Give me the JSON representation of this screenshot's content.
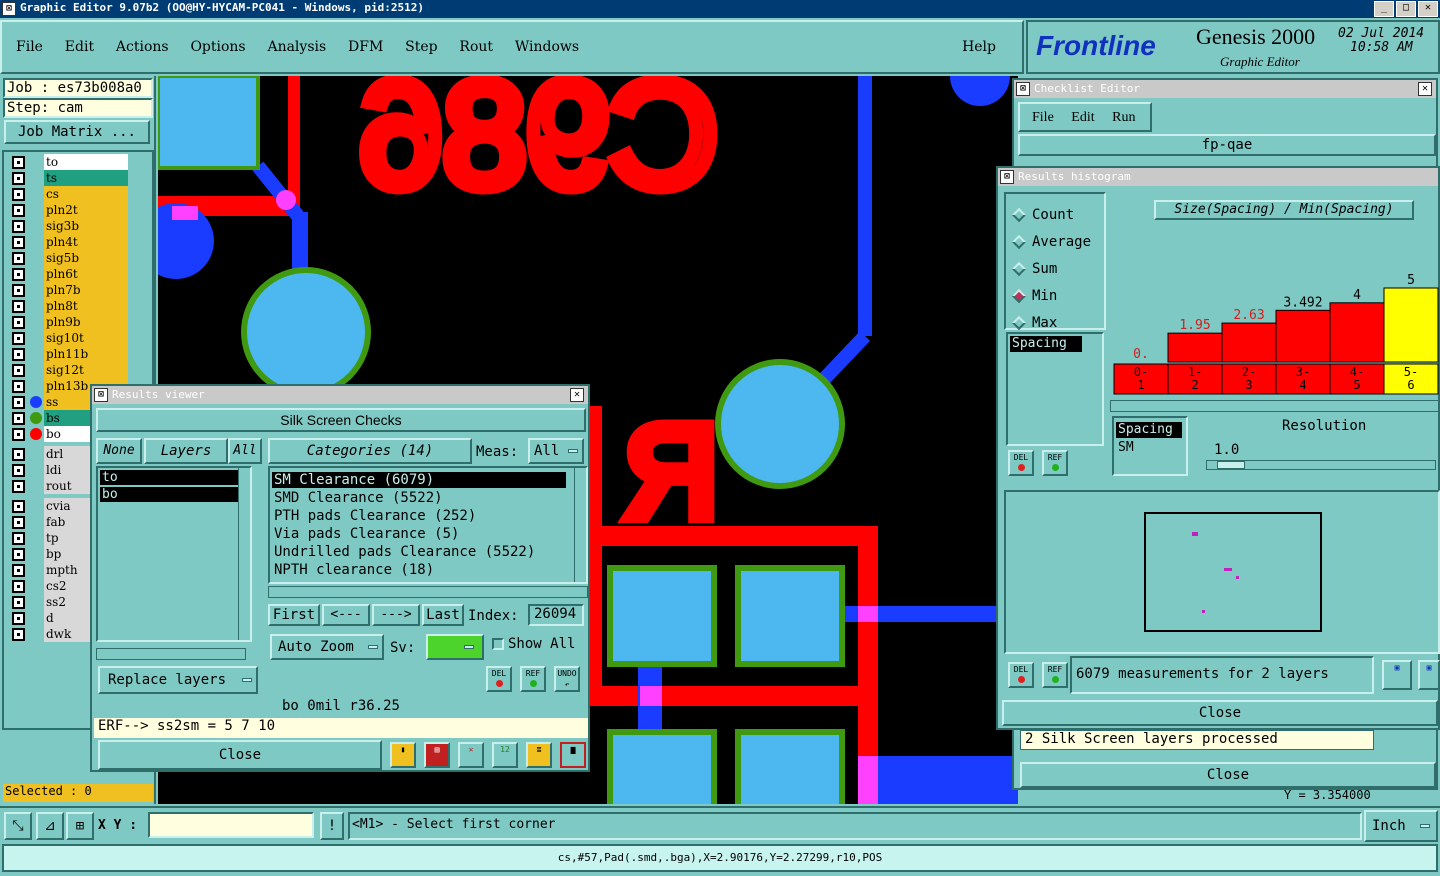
{
  "window_title": "Graphic Editor 9.07b2 (OO@HY-HYCAM-PC041 - Windows, pid:2512)",
  "menu": {
    "items": [
      "File",
      "Edit",
      "Actions",
      "Options",
      "Analysis",
      "DFM",
      "Step",
      "Rout",
      "Windows"
    ],
    "help": "Help"
  },
  "brand": {
    "logo": "Frontline",
    "product": "Genesis 2000",
    "subtitle": "Graphic Editor",
    "date": "02 Jul 2014",
    "time": "10:58 AM"
  },
  "job": {
    "job_label": "Job : es73b008a0",
    "step_label": "Step: cam",
    "matrix_button": "Job Matrix ..."
  },
  "layers": [
    "to",
    "ts",
    "cs",
    "pln2t",
    "sig3b",
    "pln4t",
    "sig5b",
    "pln6t",
    "pln7b",
    "pln8t",
    "pln9b",
    "sig10t",
    "pln11b",
    "sig12t",
    "pln13b",
    "ss",
    "bs",
    "bo",
    "drl",
    "ldi",
    "rout",
    "cvia",
    "fab",
    "tp",
    "bp",
    "mpth",
    "cs2",
    "ss2",
    "d",
    "dwk"
  ],
  "selected": "Selected : 0",
  "canvas_text": {
    "top": "C986",
    "mid": "R"
  },
  "results_viewer": {
    "title": "Results viewer",
    "header": "Silk Screen Checks",
    "none": "None",
    "layers": "Layers",
    "all": "All",
    "categories": "Categories (14)",
    "meas_label": "Meas:",
    "meas_value": "All",
    "layer_items": [
      "to",
      "bo"
    ],
    "category_items": [
      "SM Clearance (6079)",
      "SMD Clearance (5522)",
      "PTH pads Clearance (252)",
      "Via pads Clearance (5)",
      "Undrilled pads Clearance (5522)",
      "NPTH clearance (18)"
    ],
    "first": "First",
    "prev": "<---",
    "next": "--->",
    "last": "Last",
    "index_label": "Index:",
    "index_value": "26094",
    "auto_zoom": "Auto Zoom",
    "sv": "Sv:",
    "show_all": "Show All",
    "replace_layers": "Replace layers",
    "del": "DEL",
    "ref": "REF",
    "undo": "UNDO",
    "status1": "bo 0mil r36.25",
    "status2": "ERF--> ss2sm = 5 7 10",
    "close": "Close"
  },
  "checklist": {
    "title": "Checklist Editor",
    "menu": [
      "File",
      "Edit",
      "Run"
    ],
    "name": "fp-qae",
    "status": "2 Silk Screen layers processed",
    "close": "Close"
  },
  "histogram": {
    "title": "Results histogram",
    "options": [
      "Count",
      "Average",
      "Sum",
      "Min",
      "Max"
    ],
    "selected": "Min",
    "measure": "Spacing",
    "chart_title": "Size(Spacing) / Min(Spacing)",
    "bars": [
      0,
      1.95,
      2.63,
      3.492,
      4,
      5
    ],
    "labels": [
      "0.",
      "1.95",
      "2.63",
      "3.492",
      "4",
      "5"
    ],
    "bins": [
      "0-\n1",
      "1-\n2",
      "2-\n3",
      "3-\n4",
      "4-\n5",
      "5-\n6"
    ],
    "list_items": [
      "Spacing",
      "SM"
    ],
    "resolution_label": "Resolution",
    "resolution_value": "1.0",
    "measurements": "6079 measurements for 2 layers",
    "close": "Close",
    "del": "DEL",
    "ref": "REF"
  },
  "bottom": {
    "xy_label": "X Y :",
    "prompt": "<M1> - Select first corner",
    "units": "Inch",
    "status": "cs,#57,Pad(.smd,.bga),X=2.90176,Y=2.27299,r10,POS",
    "partial_y": "Y = 3.354000"
  },
  "colors": {
    "teal": "#7fc9c4",
    "red": "#ff0000",
    "blue": "#1a3cff",
    "lightblue": "#4db8f0",
    "green": "#3f9a12",
    "magenta": "#ff40ff",
    "yellow": "#f0c020"
  }
}
